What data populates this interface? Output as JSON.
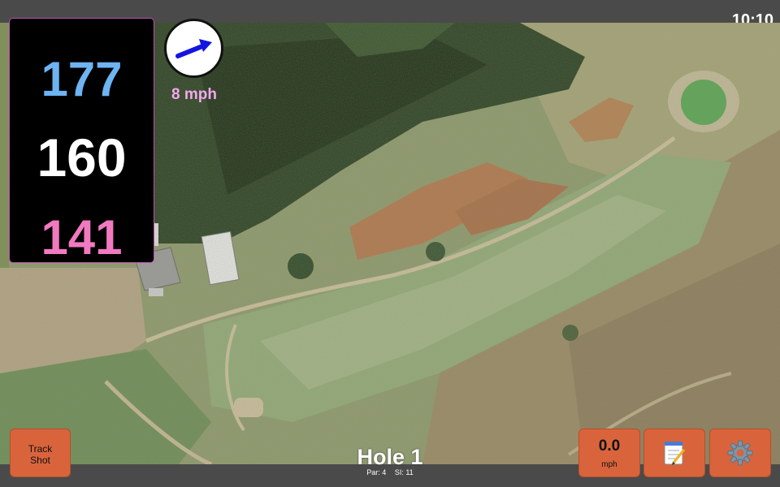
{
  "status_bar": {
    "time": "10:10"
  },
  "distances": {
    "back": "177",
    "middle": "160",
    "front": "141",
    "colors": {
      "back": "#6eb3f2",
      "middle": "#ffffff",
      "front": "#f079c0"
    }
  },
  "wind": {
    "speed_label": "8 mph",
    "arrow_icon": "arrow-east-northeast-icon",
    "color": "#f4a7f0"
  },
  "hole": {
    "title": "Hole 1",
    "par_label": "Par: 4",
    "si_label": "SI: 11"
  },
  "buttons": {
    "track_shot_line1": "Track",
    "track_shot_line2": "Shot",
    "speed_value": "0.0",
    "speed_unit": "mph",
    "notes_icon": "notepad-icon",
    "settings_icon": "gear-icon",
    "accent": "#d9643c"
  }
}
